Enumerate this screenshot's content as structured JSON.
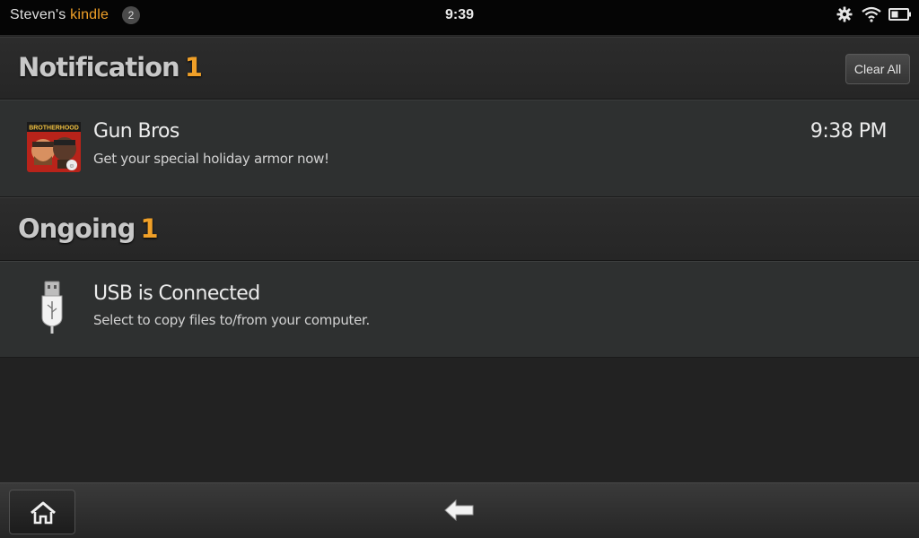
{
  "status_bar": {
    "owner": "Steven's",
    "brand": "kindle",
    "notification_count": "2",
    "time": "9:39",
    "icons": [
      "gear-icon",
      "wifi-icon",
      "battery-icon"
    ]
  },
  "notifications_section": {
    "title": "Notification",
    "count": "1",
    "clear_all_label": "Clear All"
  },
  "notification_item": {
    "icon": "gun-bros-app-icon",
    "icon_text": "BROTHERHOOD",
    "title": "Gun Bros",
    "message": "Get your special holiday armor now!",
    "time": "9:38 PM"
  },
  "ongoing_section": {
    "title": "Ongoing",
    "count": "1"
  },
  "ongoing_item": {
    "icon": "usb-icon",
    "title": "USB is Connected",
    "message": "Select to copy files to/from your computer."
  },
  "nav_bar": {
    "icons": [
      "home-icon",
      "back-arrow-icon"
    ]
  },
  "colors": {
    "accent": "#f0a028",
    "background": "#222222",
    "row": "#2e3030"
  }
}
